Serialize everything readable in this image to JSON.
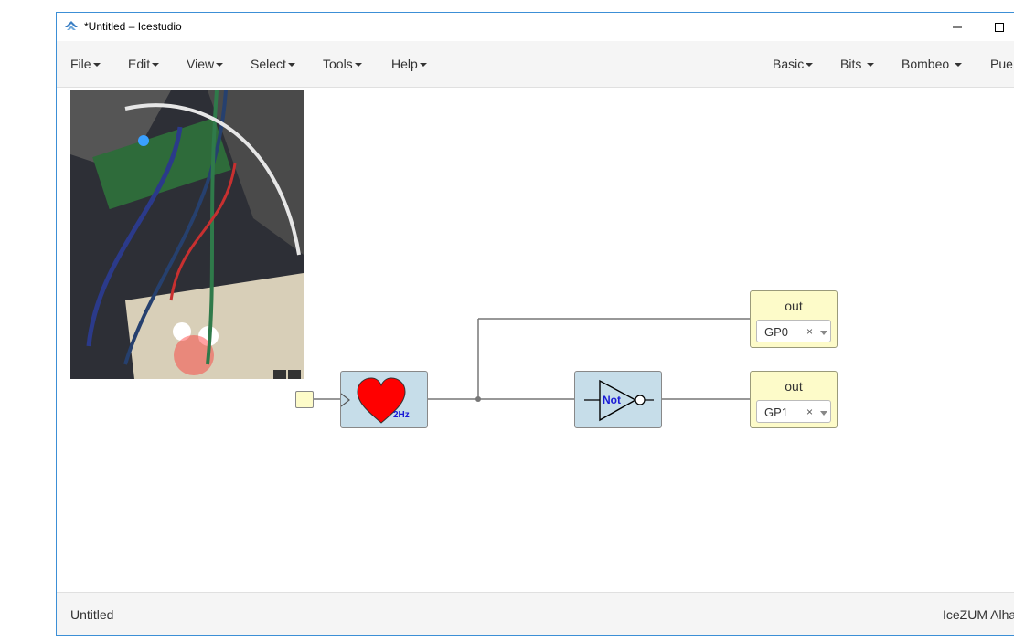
{
  "window": {
    "title": "*Untitled – Icestudio",
    "app_icon": "icestudio-logo-icon",
    "minimize_icon": "minimize-icon",
    "maximize_icon": "maximize-icon"
  },
  "menu": {
    "left": [
      {
        "label": "File"
      },
      {
        "label": "Edit"
      },
      {
        "label": "View"
      },
      {
        "label": "Select"
      },
      {
        "label": "Tools"
      },
      {
        "label": "Help"
      }
    ],
    "right": [
      {
        "label": "Basic"
      },
      {
        "label": "Bits"
      },
      {
        "label": "Bombeo"
      },
      {
        "label": "Pue"
      }
    ]
  },
  "canvas": {
    "photo": "breadboard-photo",
    "heart_block": {
      "label": "2Hz",
      "icon": "heart-icon",
      "color": "#ff0000"
    },
    "not_block": {
      "label": "Not",
      "icon": "not-gate-icon",
      "label_color": "#1a1ad6"
    },
    "out_blocks": [
      {
        "label": "out",
        "pin": "GP0",
        "clear": "×"
      },
      {
        "label": "out",
        "pin": "GP1",
        "clear": "×"
      }
    ],
    "colors": {
      "block_blue": "#c6dde9",
      "block_yellow": "#fdfbc9",
      "wire": "#777777"
    }
  },
  "status": {
    "left": "Untitled",
    "right": "IceZUM Alha"
  }
}
